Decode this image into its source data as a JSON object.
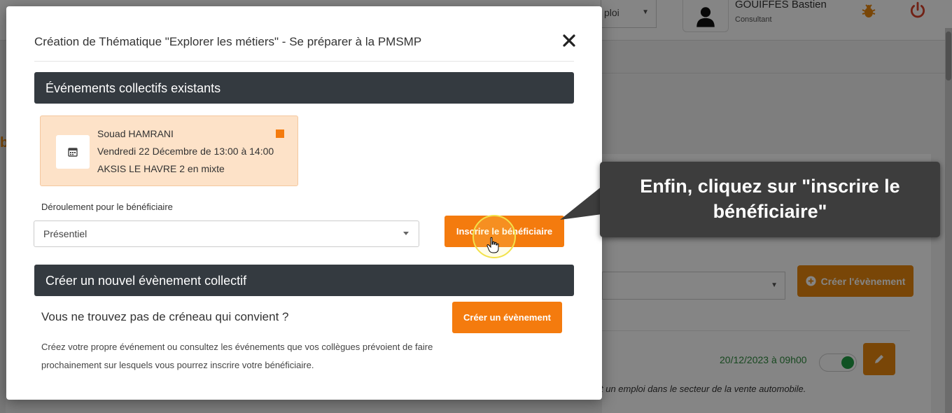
{
  "background": {
    "top_select_value": "ploi",
    "user": {
      "name": "GOUIFFES Bastien",
      "role": "Consultant"
    },
    "left_letter": "b",
    "create_event_button": "Créer l'évènement",
    "card_date": "20/12/2023 à 09h00",
    "card_description": "t un emploi dans le secteur de la vente automobile."
  },
  "modal": {
    "title": "Création de Thématique \"Explorer les métiers\" - Se préparer à la PMSMP",
    "existing_section": {
      "heading": "Événements collectifs existants"
    },
    "event": {
      "person": "Souad HAMRANI",
      "when": "Vendredi 22 Décembre de 13:00 à 14:00",
      "where": "AKSIS LE HAVRE 2 en mixte"
    },
    "mode_label": "Déroulement pour le bénéficiaire",
    "mode_value": "Présentiel",
    "register_button": "Inscrire le bénéficiaire",
    "new_section": {
      "heading": "Créer un nouvel évènement collectif"
    },
    "no_slot_title": "Vous ne trouvez pas de créneau qui convient ?",
    "create_button": "Créer un évènement",
    "no_slot_description": "Créez votre propre événement ou consultez les événements que vos collègues prévoient de faire prochainement sur lesquels vous pourrez inscrire votre bénéficiaire."
  },
  "tooltip": {
    "text": "Enfin, cliquez sur \"inscrire le bénéficiaire\""
  },
  "colors": {
    "accent": "#f47b0e",
    "header_dark": "#343a40",
    "event_bg": "#fde2c8",
    "success": "#2e8b3e"
  }
}
